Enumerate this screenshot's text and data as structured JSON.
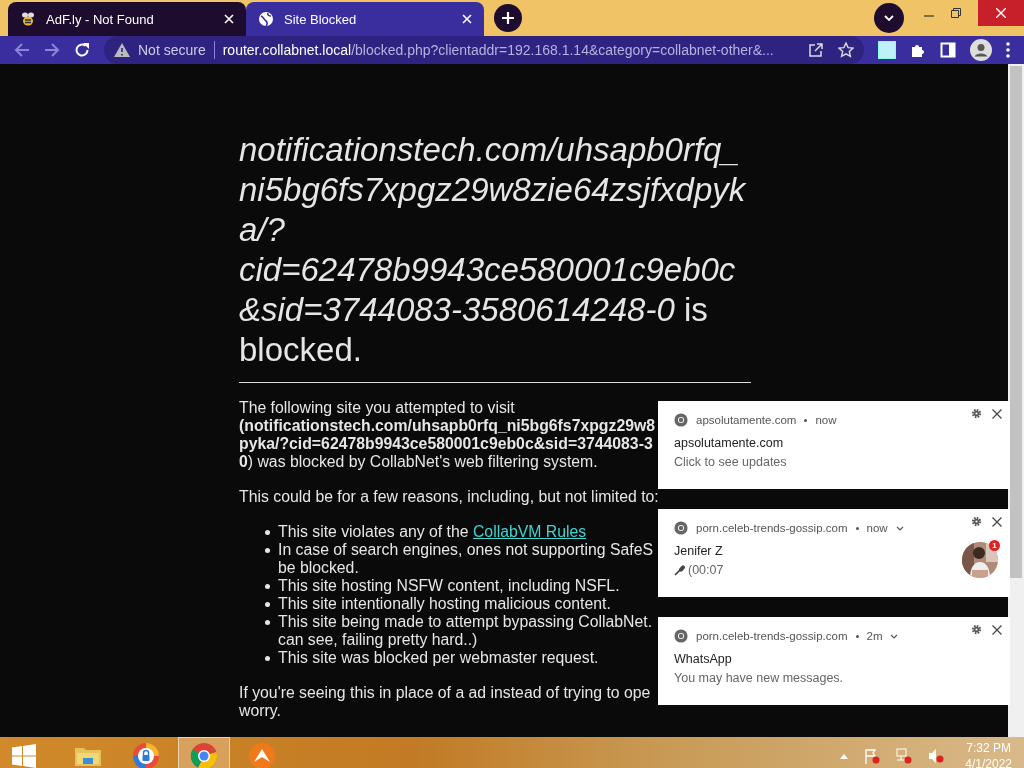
{
  "tabs": [
    {
      "title": "AdF.ly - Not Found",
      "selected": false
    },
    {
      "title": "Site Blocked",
      "selected": true
    }
  ],
  "address": {
    "security": "Not secure",
    "host": "router.collabnet.local",
    "path": "/blocked.php?clientaddr=192.168.1.14&category=collabnet-other&..."
  },
  "page": {
    "heading": "*notificationstech.com/uhsapb0rfq_ni5bg6fs7xpgz29w8zie64zsjfxdpyka/?cid=62478b9943ce580001c9eb0c&sid=3744083-3580614248-0* is blocked.",
    "intro_lines": [
      "The following site you attempted to visit",
      "**(notificationstech.com/uhsapb0rfq_ni5bg6fs7xpgz29w8**",
      "**pyka/?cid=62478b9943ce580001c9eb0c&sid=3744083-3**",
      "**0**) was blocked by CollabNet's web filtering system."
    ],
    "reasons_intro": "This could be for a few reasons, including, but not limited to:",
    "reasons": [
      {
        "lines": [
          "This site violates any of the"
        ],
        "link": "CollabVM Rules"
      },
      {
        "lines": [
          "In case of search engines, ones not supporting SafeS",
          "be blocked."
        ]
      },
      {
        "lines": [
          "This site hosting NSFW content, including NSFL."
        ]
      },
      {
        "lines": [
          "This site intentionally hosting malicious content."
        ]
      },
      {
        "lines": [
          "This site being made to attempt bypassing CollabNet.",
          "can see, failing pretty hard..)"
        ]
      },
      {
        "lines": [
          "This site was blocked per webmaster request."
        ]
      }
    ],
    "outro_lines": [
      "If you're seeing this in place of a ad instead of trying to ope",
      "worry."
    ]
  },
  "notifications": [
    {
      "origin": "apsolutamente.com",
      "time": "now",
      "menu": false,
      "title": "apsolutamente.com",
      "body": "Click to see updates",
      "voice": false
    },
    {
      "origin": "porn.celeb-trends-gossip.com",
      "time": "now",
      "menu": true,
      "title": "Jenifer Z",
      "body": "(00:07",
      "voice": true,
      "avatar": {
        "kind": "picture",
        "badge": "1"
      }
    },
    {
      "origin": "porn.celeb-trends-gossip.com",
      "time": "2m",
      "menu": true,
      "title": "WhatsApp",
      "body": "You may have new messages.",
      "voice": false
    }
  ],
  "clock": {
    "time": "7:32 PM",
    "date": "4/1/2022"
  }
}
